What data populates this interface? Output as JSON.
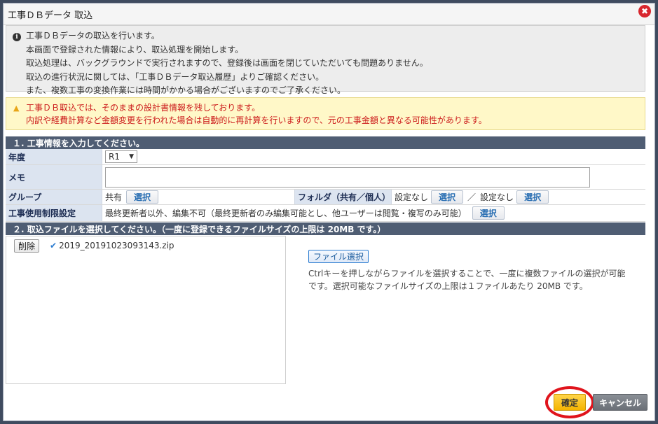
{
  "dialog": {
    "title": "工事ＤＢデータ 取込",
    "close_glyph": "✖"
  },
  "info": {
    "icon": "info-icon",
    "lines": [
      "工事ＤＢデータの取込を行います。",
      "本画面で登録された情報により、取込処理を開始します。",
      "取込処理は、バックグラウンドで実行されますので、登録後は画面を閉じていただいても問題ありません。",
      "取込の進行状況に関しては、「工事ＤＢデータ取込履歴」よりご確認ください。",
      "また、複数工事の変換作業には時間がかかる場合がございますのでご了承ください。"
    ]
  },
  "warning": {
    "icon": "warning-icon",
    "lines": [
      "工事ＤＢ取込では、そのままの設計書情報を残しております。",
      "内訳や経費計算など金額変更を行われた場合は自動的に再計算を行いますので、元の工事金額と異なる可能性があります。"
    ]
  },
  "section1": {
    "title": "１. 工事情報を入力してください。",
    "year_label": "年度",
    "year_value": "R1",
    "memo_label": "メモ",
    "group_label": "グループ",
    "group_value": "共有",
    "group_select": "選択",
    "folder_label": "フォルダ（共有／個人）",
    "folder_shared_value": "設定なし",
    "folder_shared_select": "選択",
    "folder_sep": "／",
    "folder_personal_value": "設定なし",
    "folder_personal_select": "選択",
    "restrict_label": "工事使用制限設定",
    "restrict_value": "最終更新者以外、編集不可（最終更新者のみ編集可能とし、他ユーザーは閲覧・複写のみ可能）",
    "restrict_select": "選択"
  },
  "section2": {
    "title": "２. 取込ファイルを選択してください。（一度に登録できるファイルサイズの上限は 20MB です。）",
    "delete_label": "削除",
    "file_name": "2019_20191023093143.zip",
    "file_select_label": "ファイル選択",
    "note_lines": [
      "Ctrlキーを押しながらファイルを選択することで、一度に複数ファイルの選択が可能",
      "です。選択可能なファイルサイズの上限は１ファイルあたり 20MB です。"
    ]
  },
  "footer": {
    "ok_label": "確定",
    "cancel_label": "キャンセル"
  },
  "colors": {
    "header_bg": "#4f5d73",
    "label_bg": "#dce4f0",
    "warning_text": "#cc1b1b",
    "ok_bg": "#f5b400",
    "highlight_ring": "#e0141c"
  }
}
